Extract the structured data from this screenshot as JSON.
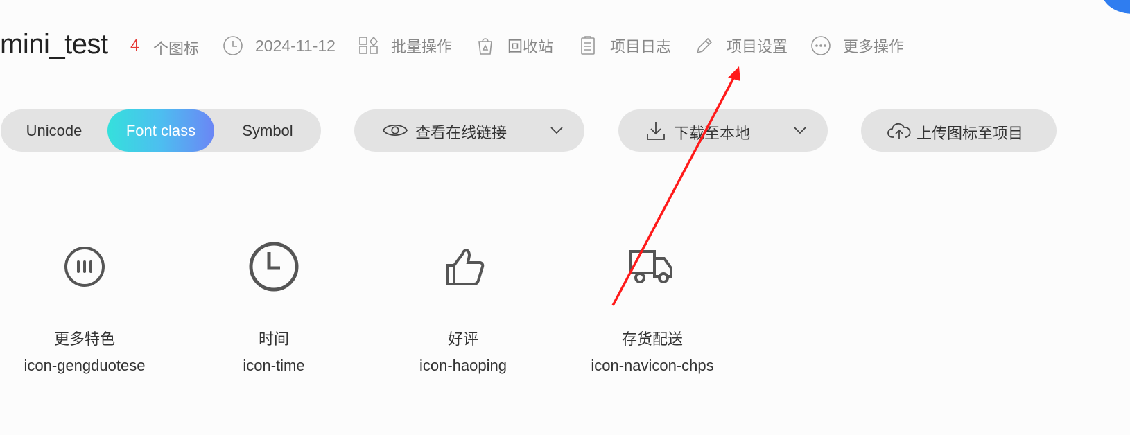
{
  "header": {
    "project_name": "mini_test",
    "icon_count": "4",
    "icon_count_label": "个图标",
    "date": "2024-11-12",
    "actions": {
      "batch": "批量操作",
      "recycle": "回收站",
      "log": "项目日志",
      "settings": "项目设置",
      "more": "更多操作"
    },
    "icons": {
      "date": "clock-icon",
      "batch": "grid-icon",
      "recycle": "trash-icon",
      "log": "clipboard-icon",
      "settings": "pencil-icon",
      "more": "ellipsis-icon"
    }
  },
  "toolbar": {
    "tabs": [
      "Unicode",
      "Font class",
      "Symbol"
    ],
    "active_tab": "Font class",
    "online_link": "查看在线链接",
    "download": "下载至本地",
    "upload": "上传图标至项目"
  },
  "icons": [
    {
      "name": "更多特色",
      "class": "icon-gengduotese",
      "icon": "more-features-icon"
    },
    {
      "name": "时间",
      "class": "icon-time",
      "icon": "clock-icon"
    },
    {
      "name": "好评",
      "class": "icon-haoping",
      "icon": "thumbs-up-icon"
    },
    {
      "name": "存货配送",
      "class": "icon-navicon-chps",
      "icon": "delivery-truck-icon"
    }
  ],
  "colors": {
    "count": "#e53935",
    "tab_gradient": [
      "#35e0dc",
      "#6b86f5"
    ],
    "annotation_arrow": "#ff1a1a",
    "pill_bg": "#e3e3e3"
  }
}
